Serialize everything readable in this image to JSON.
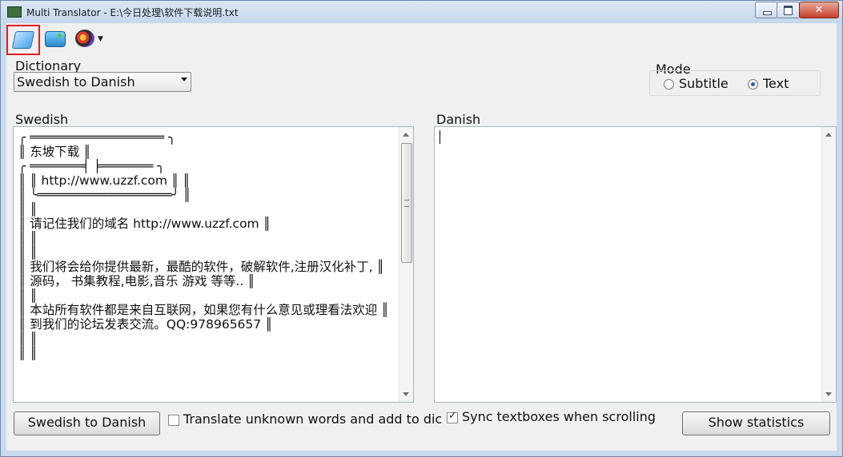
{
  "window": {
    "title": "Multi Translator - E:\\今日处理\\软件下载说明.txt"
  },
  "toolbar": {
    "buttons": [
      "dictionary-icon",
      "translate-icon",
      "paint-icon"
    ]
  },
  "dictionary": {
    "label": "Dictionary",
    "selected": "Swedish to Danish"
  },
  "mode": {
    "label": "Mode",
    "options": [
      "Subtitle",
      "Text"
    ],
    "selected": "Text"
  },
  "source": {
    "label": "Swedish",
    "lines": [
      "╭ ══════════════════ ╮",
      "  ║ 东坡下载 ║",
      " ╭ ═══════╡ ╞═══════ ╮",
      " ║ ║ http://www.uzzf.com ║ ║",
      " ║ ╰══════════════════╯ ║",
      "  ║ ║",
      " ║ 请记住我们的域名 http://www.uzzf.com ║",
      " ║ ║",
      " ║ ║",
      " ║ 我们将会给你提供最新，最酷的软件，破解软件,注册汉化补丁, ║",
      " ║ 源码， 书集教程,电影,音乐 游戏 等等.. ║",
      " ║ ║",
      " ║ 本站所有软件都是来自互联网，如果您有什么意见或理看法欢迎 ║",
      " ║ 到我们的论坛发表交流。QQ:978965657 ║",
      " ║ ║",
      "  ║ ║"
    ]
  },
  "target": {
    "label": "Danish",
    "text": ""
  },
  "footer": {
    "translate_button": "Swedish to Danish",
    "unknown_words_label": "Translate unknown words and add to dic",
    "sync_label": "Sync textboxes when scrolling",
    "stats_button": "Show statistics",
    "unknown_words_checked": false,
    "sync_checked": true
  }
}
